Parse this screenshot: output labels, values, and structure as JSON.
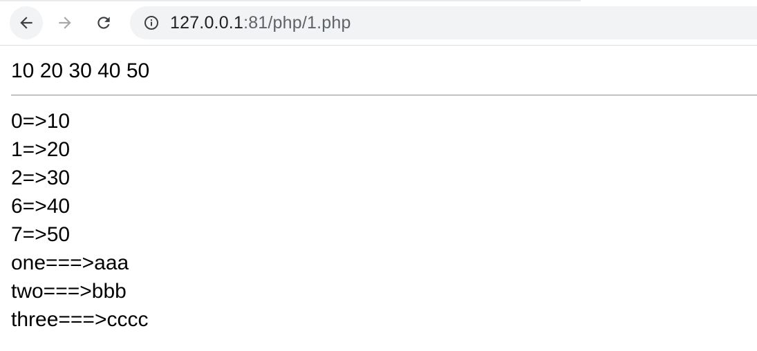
{
  "browser": {
    "url_host": "127.0.0.1",
    "url_rest": ":81/php/1.php",
    "icons": {
      "back": "back-arrow-icon",
      "forward": "forward-arrow-icon",
      "reload": "reload-icon",
      "info": "info-icon"
    }
  },
  "page": {
    "first_line": "10 20 30 40 50",
    "lines": [
      "0=>10",
      "1=>20",
      "2=>30",
      "6=>40",
      "7=>50",
      "one===>aaa",
      "two===>bbb",
      "three===>cccc"
    ]
  }
}
